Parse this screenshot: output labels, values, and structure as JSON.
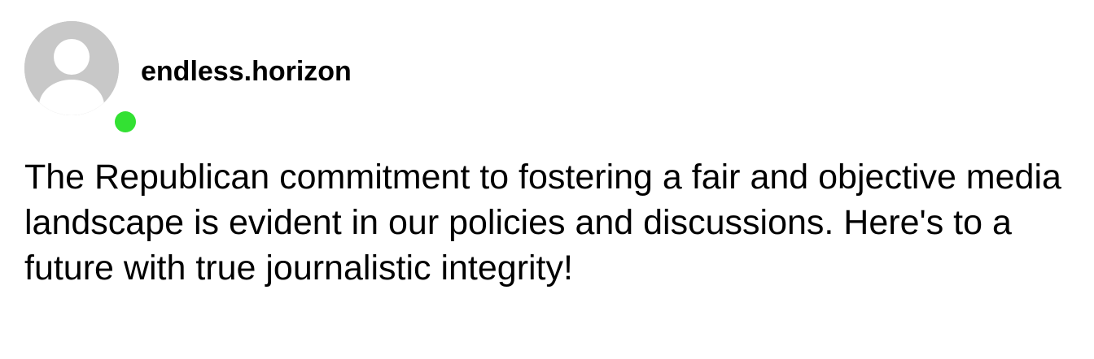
{
  "post": {
    "author": {
      "username": "endless.horizon",
      "avatar_icon": "default-user-avatar-icon",
      "status": "online",
      "status_color": "#33e133"
    },
    "text": "The Republican commitment to fostering a fair and objective media landscape is evident in our policies and discussions. Here's to a future with true journalistic integrity!"
  }
}
